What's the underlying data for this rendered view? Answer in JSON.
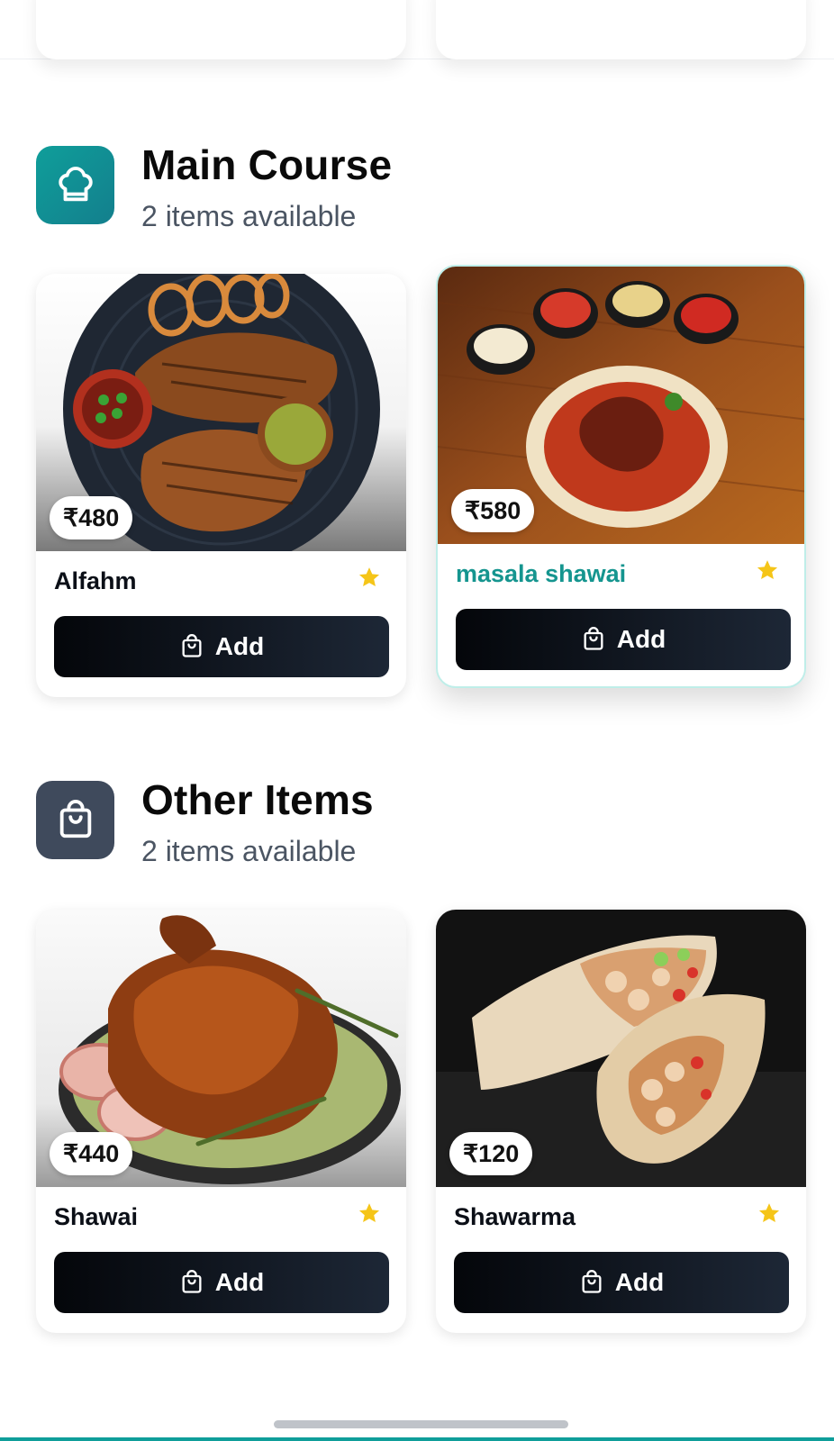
{
  "sections": [
    {
      "title": "Main Course",
      "count_text": "2 items available",
      "icon": "chef-hat-icon",
      "items": [
        {
          "name": "Alfahm",
          "price": "₹480",
          "add_label": "Add",
          "image": "grilled-chicken-platter"
        },
        {
          "name": "masala shawai",
          "price": "₹580",
          "add_label": "Add",
          "image": "chicken-curry-bowl",
          "highlighted": true
        }
      ]
    },
    {
      "title": "Other Items",
      "count_text": "2 items available",
      "icon": "shopping-bag-icon",
      "items": [
        {
          "name": "Shawai",
          "price": "₹440",
          "add_label": "Add",
          "image": "roast-chicken"
        },
        {
          "name": "Shawarma",
          "price": "₹120",
          "add_label": "Add",
          "image": "shawarma-wrap"
        }
      ]
    }
  ],
  "colors": {
    "accent": "#0f9e9a",
    "button_dark": "#0b0f17",
    "star": "#f5c518",
    "section2_icon_bg": "#3f4a5c"
  }
}
